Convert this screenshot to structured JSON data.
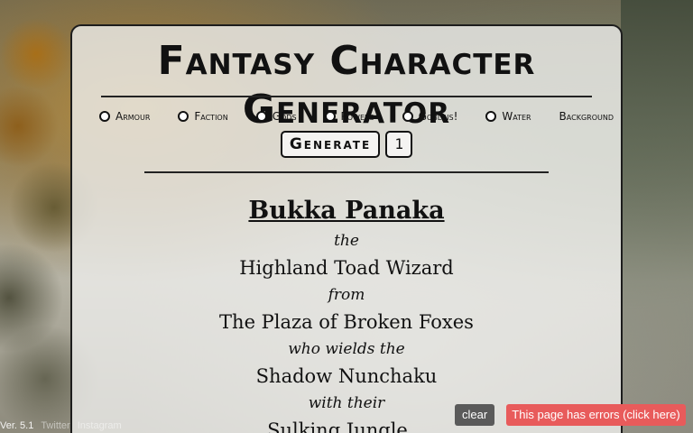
{
  "header": {
    "title": "Fantasy Character Generator"
  },
  "options": [
    {
      "label": "Armour",
      "has_radio": true
    },
    {
      "label": "Faction",
      "has_radio": true
    },
    {
      "label": "Gods",
      "has_radio": true
    },
    {
      "label": "Powers",
      "has_radio": true
    },
    {
      "label": "Goblins!",
      "has_radio": true
    },
    {
      "label": "Water",
      "has_radio": true
    },
    {
      "label": "Background",
      "has_radio": false
    }
  ],
  "generator": {
    "button_label": "Generate",
    "count": "1"
  },
  "result": {
    "name": "Bukka Panaka",
    "joiner_1": "the",
    "class": "Highland Toad Wizard",
    "joiner_2": "from",
    "origin": "The Plaza of Broken Foxes",
    "joiner_3": "who wields the",
    "weapon": "Shadow Nunchaku",
    "joiner_4": "with their",
    "companion": "Sulking Jungle..."
  },
  "footer": {
    "version": "Ver. 5.1",
    "twitter": "Twitter",
    "instagram": "Instagram"
  },
  "toolbar": {
    "clear_label": " clear",
    "error_label": "This page has errors (click here)"
  },
  "colors": {
    "panel_bg": "#ecebe9",
    "border": "#1d1d1d",
    "error": "#e85b5b",
    "clear": "#5a5a5a"
  }
}
